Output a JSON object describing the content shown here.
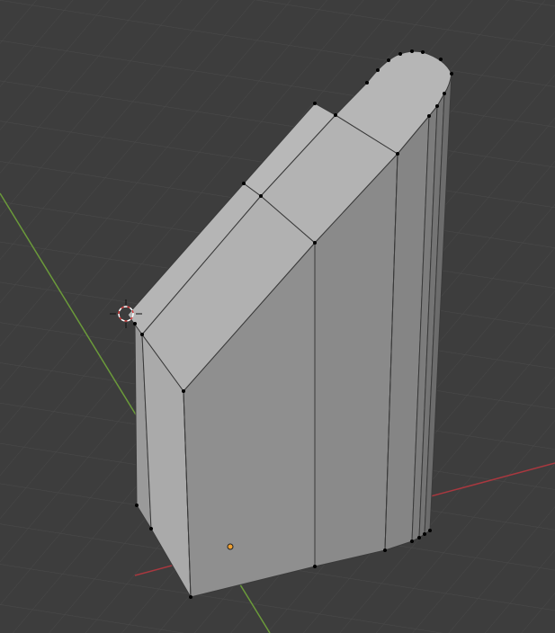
{
  "viewport": {
    "background": "#3d3d3d",
    "grid_color": "#4a4a4a",
    "x_axis_color": "#a8383f",
    "y_axis_color": "#6b9a3a"
  },
  "object": {
    "face_light": "#b9b9b9",
    "face_mid": "#9e9e9e",
    "face_dark": "#8a8a8a",
    "edge_color": "#3a3a3a",
    "vertex_color": "#000000"
  },
  "gizmos": {
    "cursor_icon": "3d-cursor-icon",
    "origin_icon": "object-origin-icon",
    "origin_color": "#f0a030"
  }
}
